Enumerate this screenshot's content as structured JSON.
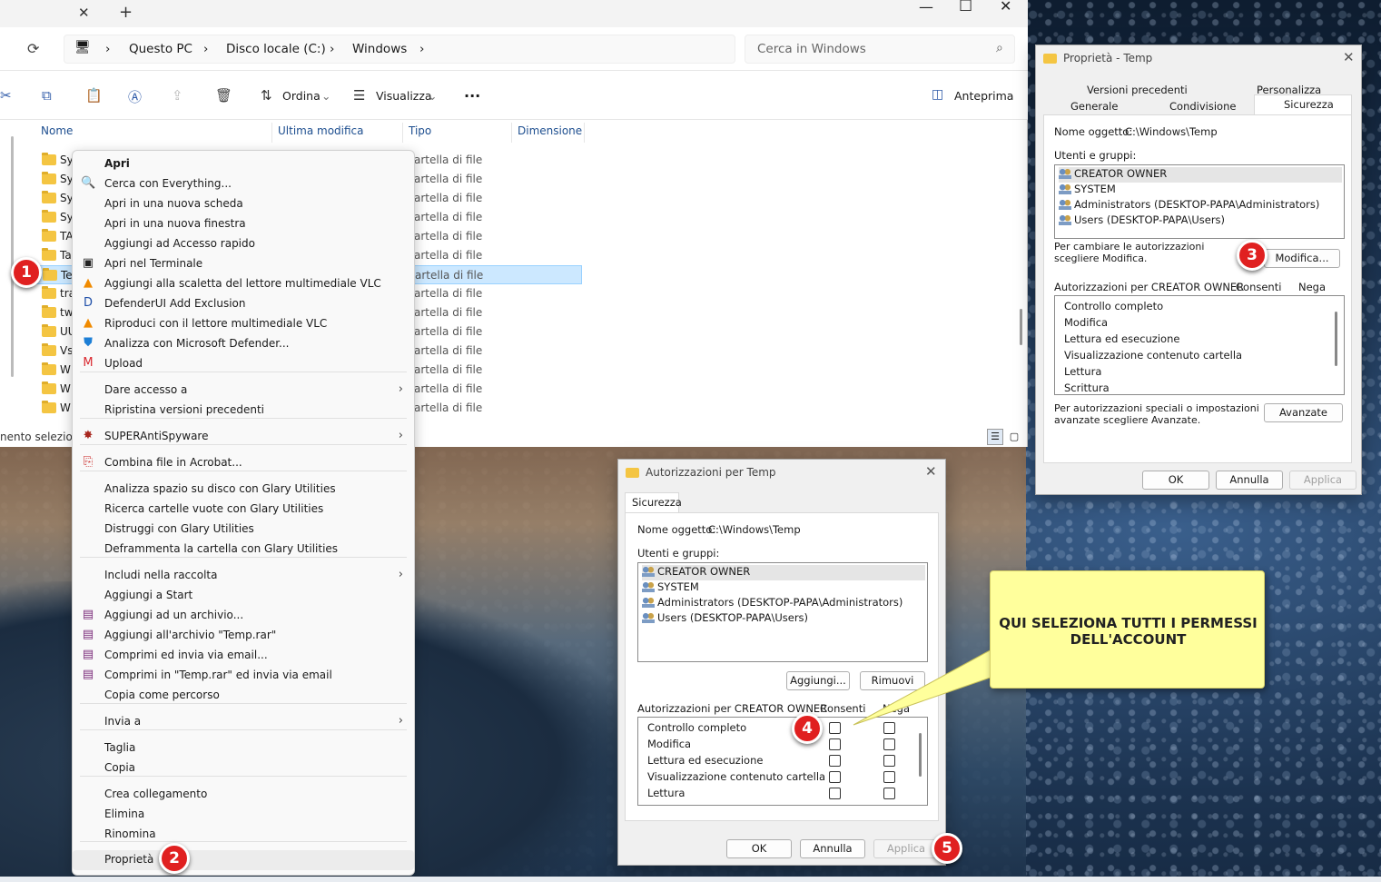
{
  "explorer": {
    "breadcrumb": [
      "Questo PC",
      "Disco locale (C:)",
      "Windows"
    ],
    "search_placeholder": "Cerca in Windows",
    "toolbar": {
      "sort": "Ordina",
      "view": "Visualizza",
      "more": "...",
      "preview": "Anteprima"
    },
    "columns": [
      "Nome",
      "Ultima modifica",
      "Tipo",
      "Dimensione"
    ],
    "rows": [
      {
        "name": "Sy",
        "type": "artella di file"
      },
      {
        "name": "Sy",
        "type": "artella di file"
      },
      {
        "name": "Sy",
        "type": "artella di file"
      },
      {
        "name": "Sy",
        "type": "artella di file"
      },
      {
        "name": "TA",
        "type": "artella di file"
      },
      {
        "name": "Ta",
        "type": "artella di file"
      },
      {
        "name": "Te",
        "type": "artella di file"
      },
      {
        "name": "tra",
        "type": "artella di file"
      },
      {
        "name": "tw",
        "type": "artella di file"
      },
      {
        "name": "UU",
        "type": "artella di file"
      },
      {
        "name": "Vs",
        "type": "artella di file"
      },
      {
        "name": "W",
        "type": "artella di file"
      },
      {
        "name": "W",
        "type": "artella di file"
      },
      {
        "name": "W",
        "type": "artella di file"
      }
    ],
    "status": "nento seleziona"
  },
  "context_menu": {
    "items": [
      {
        "label": "Apri",
        "bold": true
      },
      {
        "label": "Cerca con Everything...",
        "icon": "magnifier-icon"
      },
      {
        "label": "Apri in una nuova scheda"
      },
      {
        "label": "Apri in una nuova finestra"
      },
      {
        "label": "Aggiungi ad Accesso rapido"
      },
      {
        "label": "Apri nel Terminale",
        "icon": "terminal-icon"
      },
      {
        "label": "Aggiungi alla scaletta del lettore multimediale VLC",
        "icon": "vlc-icon"
      },
      {
        "label": "DefenderUI Add Exclusion",
        "icon": "defenderui-icon"
      },
      {
        "label": "Riproduci con il lettore multimediale VLC",
        "icon": "vlc-icon"
      },
      {
        "label": "Analizza con Microsoft Defender...",
        "icon": "defender-shield-icon"
      },
      {
        "label": "Upload",
        "icon": "mega-icon"
      },
      {
        "label": "Dare accesso a",
        "submenu": true
      },
      {
        "label": "Ripristina versioni precedenti"
      },
      {
        "label": "SUPERAntiSpyware",
        "icon": "superantispyware-icon",
        "submenu": true
      },
      {
        "label": "Combina file in Acrobat...",
        "icon": "acrobat-icon"
      },
      {
        "label": "Analizza spazio su disco con Glary Utilities"
      },
      {
        "label": "Ricerca cartelle vuote con Glary Utilities"
      },
      {
        "label": "Distruggi con Glary Utilities"
      },
      {
        "label": "Deframmenta la cartella con Glary Utilities"
      },
      {
        "label": "Includi nella raccolta",
        "submenu": true
      },
      {
        "label": "Aggiungi a Start"
      },
      {
        "label": "Aggiungi ad un archivio...",
        "icon": "winrar-icon"
      },
      {
        "label": "Aggiungi all'archivio \"Temp.rar\"",
        "icon": "winrar-icon"
      },
      {
        "label": "Comprimi ed invia via email...",
        "icon": "winrar-icon"
      },
      {
        "label": "Comprimi in \"Temp.rar\" ed invia via email",
        "icon": "winrar-icon"
      },
      {
        "label": "Copia come percorso"
      },
      {
        "label": "Invia a",
        "submenu": true
      },
      {
        "label": "Taglia"
      },
      {
        "label": "Copia"
      },
      {
        "label": "Crea collegamento"
      },
      {
        "label": "Elimina"
      },
      {
        "label": "Rinomina"
      },
      {
        "label": "Proprietà"
      }
    ]
  },
  "props_dialog": {
    "title": "Proprietà - Temp",
    "tabs_top": [
      "Versioni precedenti",
      "Personalizza"
    ],
    "tabs_bottom": [
      "Generale",
      "Condivisione",
      "Sicurezza"
    ],
    "object_label": "Nome oggetto:",
    "object_value": "C:\\Windows\\Temp",
    "users_label": "Utenti e gruppi:",
    "users": [
      "CREATOR OWNER",
      "SYSTEM",
      "Administrators (DESKTOP-PAPA\\Administrators)",
      "Users (DESKTOP-PAPA\\Users)"
    ],
    "change_hint_1": "Per cambiare le autorizzazioni",
    "change_hint_2": "scegliere Modifica.",
    "edit_button": "Modifica...",
    "perm_header": "Autorizzazioni per CREATOR OWNER",
    "allow": "Consenti",
    "deny": "Nega",
    "perms": [
      "Controllo completo",
      "Modifica",
      "Lettura ed esecuzione",
      "Visualizzazione contenuto cartella",
      "Lettura",
      "Scrittura"
    ],
    "advanced_hint_1": "Per autorizzazioni speciali o impostazioni",
    "advanced_hint_2": "avanzate scegliere Avanzate.",
    "advanced_button": "Avanzate",
    "ok": "OK",
    "cancel": "Annulla",
    "apply": "Applica"
  },
  "perm_dialog": {
    "title": "Autorizzazioni per Temp",
    "tab": "Sicurezza",
    "object_label": "Nome oggetto:",
    "object_value": "C:\\Windows\\Temp",
    "users_label": "Utenti e gruppi:",
    "users": [
      "CREATOR OWNER",
      "SYSTEM",
      "Administrators (DESKTOP-PAPA\\Administrators)",
      "Users (DESKTOP-PAPA\\Users)"
    ],
    "add_button": "Aggiungi...",
    "remove_button": "Rimuovi",
    "perm_header": "Autorizzazioni per CREATOR OWNER",
    "allow": "Consenti",
    "deny": "Nega",
    "perms": [
      "Controllo completo",
      "Modifica",
      "Lettura ed esecuzione",
      "Visualizzazione contenuto cartella",
      "Lettura"
    ],
    "ok": "OK",
    "cancel": "Annulla",
    "apply": "Applica"
  },
  "note": {
    "text": "QUI SELEZIONA TUTTI I PERMESSI DELL'ACCOUNT"
  },
  "badges": [
    "1",
    "2",
    "3",
    "4",
    "5"
  ]
}
